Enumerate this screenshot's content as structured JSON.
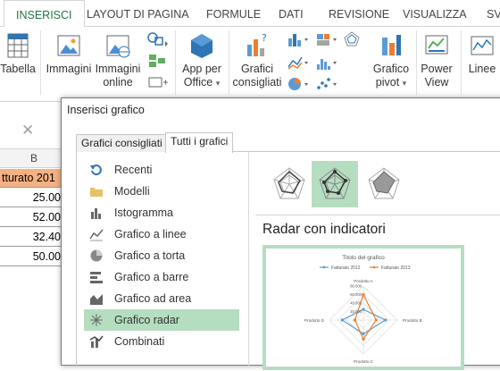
{
  "ribbon_tabs": [
    "INSERISCI",
    "LAYOUT DI PAGINA",
    "FORMULE",
    "DATI",
    "REVISIONE",
    "VISUALIZZA",
    "SVI"
  ],
  "ribbon": {
    "tabella": "Tabella",
    "immagini": "Immagini",
    "immagini_online_1": "Immagini",
    "immagini_online_2": "online",
    "app_1": "App per",
    "app_2": "Office",
    "grafici_1": "Grafici",
    "grafici_2": "consigliati",
    "pivot_1": "Grafico",
    "pivot_2": "pivot",
    "power_1": "Power",
    "power_2": "View",
    "linee": "Linee",
    "dropdown_arrow": "▾"
  },
  "sheet": {
    "cancel_glyph": "✕",
    "column": "B",
    "header_cell": "tturato 201",
    "values": [
      "25.00",
      "52.00",
      "32.40",
      "50.00"
    ]
  },
  "dialog": {
    "title": "Inserisci grafico",
    "tabs": [
      "Grafici consigliati",
      "Tutti i grafici"
    ],
    "categories": [
      "Recenti",
      "Modelli",
      "Istogramma",
      "Grafico a linee",
      "Grafico a torta",
      "Grafico a barre",
      "Grafico ad area",
      "Grafico radar",
      "Combinati"
    ],
    "selected_category": "Grafico radar",
    "chart_heading": "Radar con indicatori",
    "preview": {
      "title": "Titolo del grafico",
      "legend": [
        "Fatturato 2012",
        "Fatturato 2013"
      ],
      "axes": [
        "Prodotto A",
        "Prodotto B",
        "Prodotto C",
        "Prodotto D"
      ],
      "ticks": [
        "80.000",
        "60.000",
        "40.000",
        "20.000",
        "-"
      ]
    }
  },
  "colors": {
    "accent": "#217346",
    "selection": "#b5dec1",
    "header_cell": "#f4b183",
    "series_2012": "#5b9bd5",
    "series_2013": "#ed7d31"
  },
  "chart_data": {
    "type": "radar",
    "title": "Titolo del grafico",
    "categories": [
      "Prodotto A",
      "Prodotto B",
      "Prodotto C",
      "Prodotto D"
    ],
    "series": [
      {
        "name": "Fatturato 2012",
        "values": [
          25,
          52,
          32.4,
          50
        ]
      },
      {
        "name": "Fatturato 2013",
        "values": [
          60,
          30,
          45,
          20
        ]
      }
    ],
    "ticks": [
      "80.000",
      "60.000",
      "40.000",
      "20.000",
      "-"
    ]
  }
}
